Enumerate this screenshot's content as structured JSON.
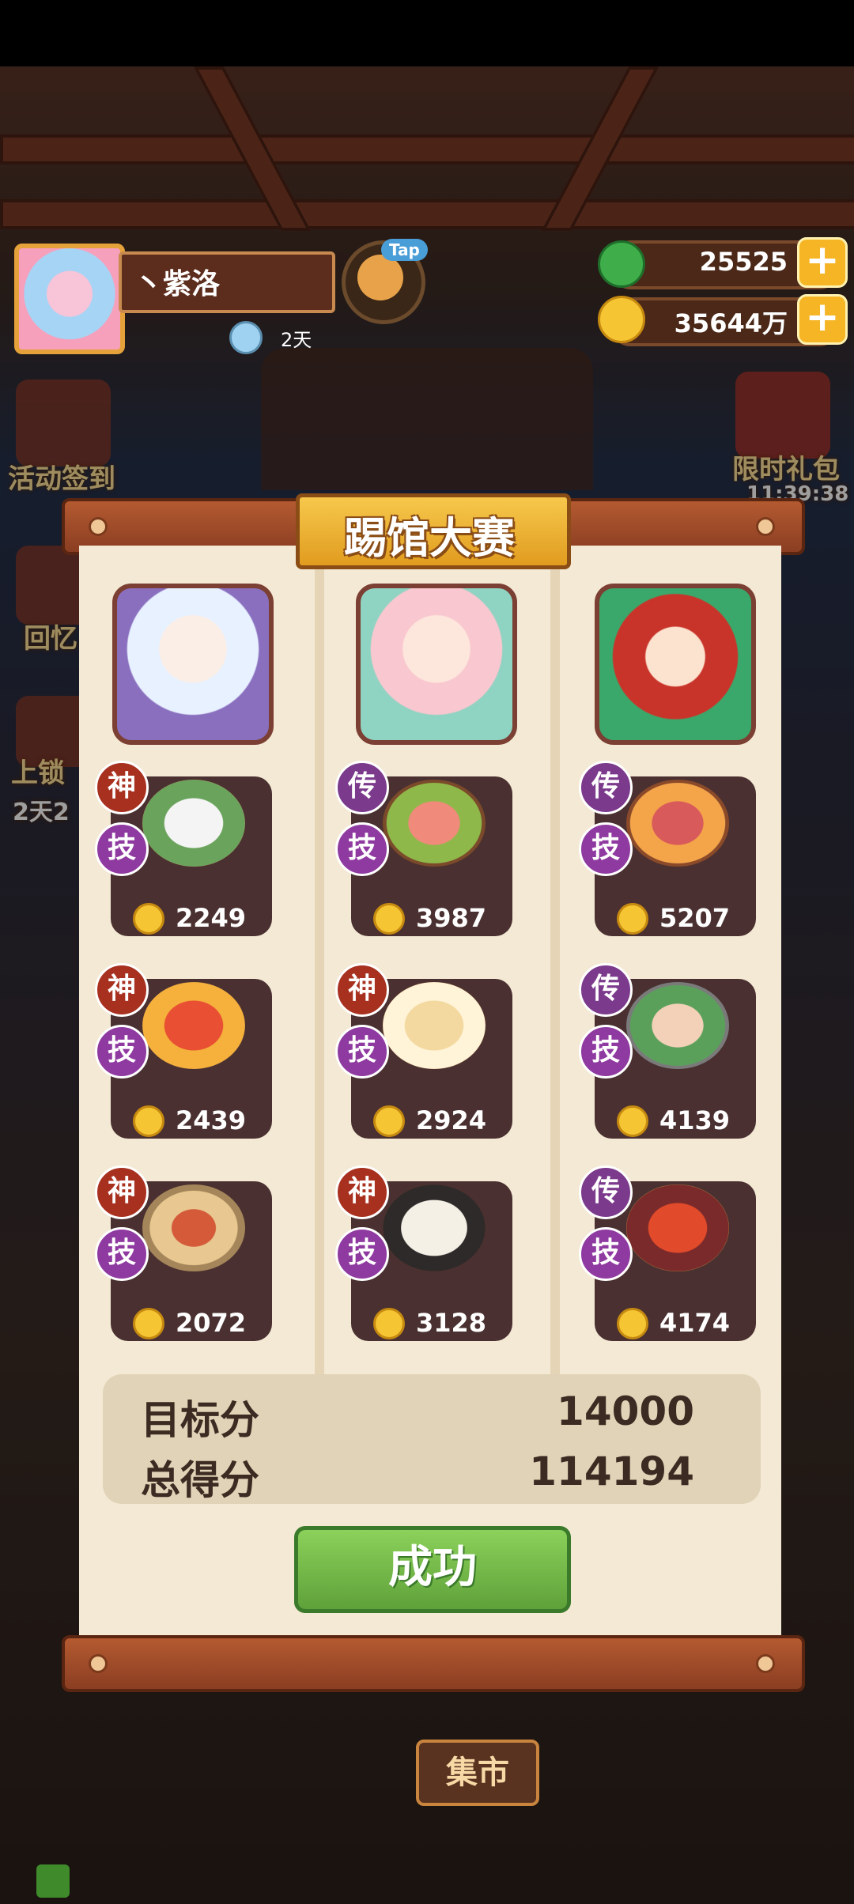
{
  "player": {
    "name": "丶紫洛",
    "days": "2天"
  },
  "tap_label": "Tap",
  "resources": [
    {
      "name": "jade",
      "value": "25525",
      "icon": "jade-icon",
      "color": "#3fae4a"
    },
    {
      "name": "coins",
      "value": "35644万",
      "icon": "coin-icon",
      "color": "#f5c534"
    }
  ],
  "side_menu": {
    "left": [
      {
        "label": "活动签到",
        "sub": "2"
      },
      {
        "label": "回忆"
      },
      {
        "label": "上锁",
        "sub": "2天2"
      }
    ],
    "right": [
      {
        "label": "限时礼包",
        "sub": "11:39:38"
      }
    ]
  },
  "panel": {
    "title": "踢馆大赛",
    "columns": [
      {
        "dishes": [
          {
            "rank": "神",
            "skill": "技",
            "cost": "2249"
          },
          {
            "rank": "神",
            "skill": "技",
            "cost": "2439"
          },
          {
            "rank": "神",
            "skill": "技",
            "cost": "2072"
          }
        ]
      },
      {
        "dishes": [
          {
            "rank": "传",
            "skill": "技",
            "cost": "3987"
          },
          {
            "rank": "神",
            "skill": "技",
            "cost": "2924"
          },
          {
            "rank": "神",
            "skill": "技",
            "cost": "3128"
          }
        ]
      },
      {
        "dishes": [
          {
            "rank": "传",
            "skill": "技",
            "cost": "5207"
          },
          {
            "rank": "传",
            "skill": "技",
            "cost": "4139"
          },
          {
            "rank": "传",
            "skill": "技",
            "cost": "4174"
          }
        ]
      }
    ],
    "target_label": "目标分",
    "target_value": "14000",
    "total_label": "总得分",
    "total_value": "114194",
    "success_label": "成功"
  },
  "market_label": "集市"
}
